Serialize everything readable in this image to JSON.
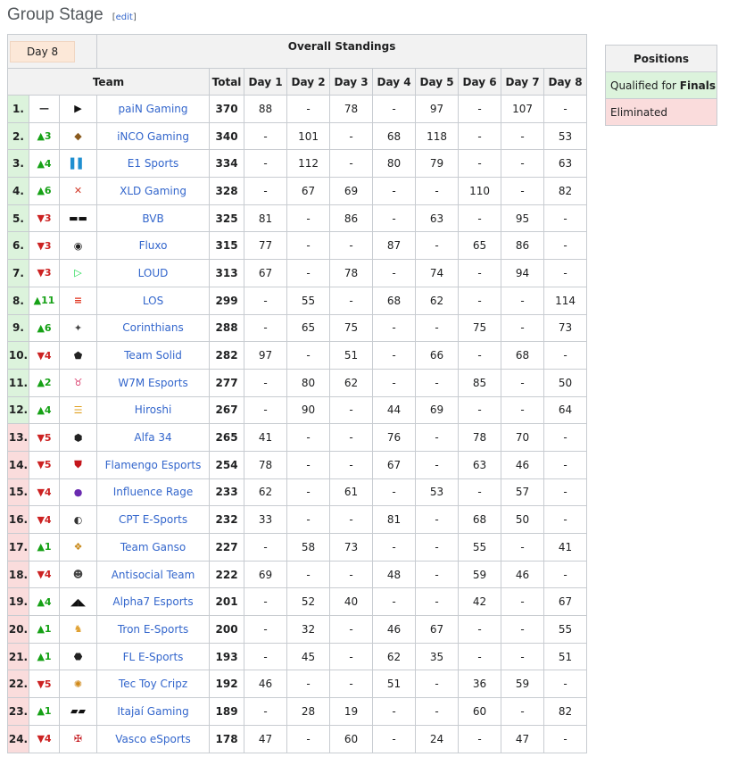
{
  "page": {
    "title": "Group Stage",
    "edit_label": "edit"
  },
  "table": {
    "day_selector": "Day 8",
    "overall_title": "Overall Standings",
    "headers": {
      "team": "Team",
      "total": "Total",
      "days": [
        "Day 1",
        "Day 2",
        "Day 3",
        "Day 4",
        "Day 5",
        "Day 6",
        "Day 7",
        "Day 8"
      ]
    },
    "rows": [
      {
        "rank": "1.",
        "change": "—",
        "dir": "same",
        "logo": "pain-gaming-logo",
        "name": "paiN Gaming",
        "total": "370",
        "days": [
          "88",
          "-",
          "78",
          "-",
          "97",
          "-",
          "107",
          "-"
        ],
        "status": "q"
      },
      {
        "rank": "2.",
        "change": "▲3",
        "dir": "up",
        "logo": "inco-gaming-logo",
        "name": "iNCO Gaming",
        "total": "340",
        "days": [
          "-",
          "101",
          "-",
          "68",
          "118",
          "-",
          "-",
          "53"
        ],
        "status": "q"
      },
      {
        "rank": "3.",
        "change": "▲4",
        "dir": "up",
        "logo": "e1-sports-logo",
        "name": "E1 Sports",
        "total": "334",
        "days": [
          "-",
          "112",
          "-",
          "80",
          "79",
          "-",
          "-",
          "63"
        ],
        "status": "q"
      },
      {
        "rank": "4.",
        "change": "▲6",
        "dir": "up",
        "logo": "xld-gaming-logo",
        "name": "XLD Gaming",
        "total": "328",
        "days": [
          "-",
          "67",
          "69",
          "-",
          "-",
          "110",
          "-",
          "82"
        ],
        "status": "q"
      },
      {
        "rank": "5.",
        "change": "▼3",
        "dir": "down",
        "logo": "bvb-logo",
        "name": "BVB",
        "total": "325",
        "days": [
          "81",
          "-",
          "86",
          "-",
          "63",
          "-",
          "95",
          "-"
        ],
        "status": "q"
      },
      {
        "rank": "6.",
        "change": "▼3",
        "dir": "down",
        "logo": "fluxo-logo",
        "name": "Fluxo",
        "total": "315",
        "days": [
          "77",
          "-",
          "-",
          "87",
          "-",
          "65",
          "86",
          "-"
        ],
        "status": "q"
      },
      {
        "rank": "7.",
        "change": "▼3",
        "dir": "down",
        "logo": "loud-logo",
        "name": "LOUD",
        "total": "313",
        "days": [
          "67",
          "-",
          "78",
          "-",
          "74",
          "-",
          "94",
          "-"
        ],
        "status": "q"
      },
      {
        "rank": "8.",
        "change": "▲11",
        "dir": "up",
        "logo": "los-logo",
        "name": "LOS",
        "total": "299",
        "days": [
          "-",
          "55",
          "-",
          "68",
          "62",
          "-",
          "-",
          "114"
        ],
        "status": "q"
      },
      {
        "rank": "9.",
        "change": "▲6",
        "dir": "up",
        "logo": "corinthians-logo",
        "name": "Corinthians",
        "total": "288",
        "days": [
          "-",
          "65",
          "75",
          "-",
          "-",
          "75",
          "-",
          "73"
        ],
        "status": "q"
      },
      {
        "rank": "10.",
        "change": "▼4",
        "dir": "down",
        "logo": "team-solid-logo",
        "name": "Team Solid",
        "total": "282",
        "days": [
          "97",
          "-",
          "51",
          "-",
          "66",
          "-",
          "68",
          "-"
        ],
        "status": "q"
      },
      {
        "rank": "11.",
        "change": "▲2",
        "dir": "up",
        "logo": "w7m-esports-logo",
        "name": "W7M Esports",
        "total": "277",
        "days": [
          "-",
          "80",
          "62",
          "-",
          "-",
          "85",
          "-",
          "50"
        ],
        "status": "q"
      },
      {
        "rank": "12.",
        "change": "▲4",
        "dir": "up",
        "logo": "hiroshi-logo",
        "name": "Hiroshi",
        "total": "267",
        "days": [
          "-",
          "90",
          "-",
          "44",
          "69",
          "-",
          "-",
          "64"
        ],
        "status": "q"
      },
      {
        "rank": "13.",
        "change": "▼5",
        "dir": "down",
        "logo": "alfa34-logo",
        "name": "Alfa 34",
        "total": "265",
        "days": [
          "41",
          "-",
          "-",
          "76",
          "-",
          "78",
          "70",
          "-"
        ],
        "status": "e"
      },
      {
        "rank": "14.",
        "change": "▼5",
        "dir": "down",
        "logo": "flamengo-logo",
        "name": "Flamengo Esports",
        "total": "254",
        "days": [
          "78",
          "-",
          "-",
          "67",
          "-",
          "63",
          "46",
          "-"
        ],
        "status": "e"
      },
      {
        "rank": "15.",
        "change": "▼4",
        "dir": "down",
        "logo": "influence-rage-logo",
        "name": "Influence Rage",
        "total": "233",
        "days": [
          "62",
          "-",
          "61",
          "-",
          "53",
          "-",
          "57",
          "-"
        ],
        "status": "e"
      },
      {
        "rank": "16.",
        "change": "▼4",
        "dir": "down",
        "logo": "cpt-esports-logo",
        "name": "CPT E-Sports",
        "total": "232",
        "days": [
          "33",
          "-",
          "-",
          "81",
          "-",
          "68",
          "50",
          "-"
        ],
        "status": "e"
      },
      {
        "rank": "17.",
        "change": "▲1",
        "dir": "up",
        "logo": "team-ganso-logo",
        "name": "Team Ganso",
        "total": "227",
        "days": [
          "-",
          "58",
          "73",
          "-",
          "-",
          "55",
          "-",
          "41"
        ],
        "status": "e"
      },
      {
        "rank": "18.",
        "change": "▼4",
        "dir": "down",
        "logo": "antisocial-team-logo",
        "name": "Antisocial Team",
        "total": "222",
        "days": [
          "69",
          "-",
          "-",
          "48",
          "-",
          "59",
          "46",
          "-"
        ],
        "status": "e"
      },
      {
        "rank": "19.",
        "change": "▲4",
        "dir": "up",
        "logo": "alpha7-logo",
        "name": "Alpha7 Esports",
        "total": "201",
        "days": [
          "-",
          "52",
          "40",
          "-",
          "-",
          "42",
          "-",
          "67"
        ],
        "status": "e"
      },
      {
        "rank": "20.",
        "change": "▲1",
        "dir": "up",
        "logo": "tron-esports-logo",
        "name": "Tron E-Sports",
        "total": "200",
        "days": [
          "-",
          "32",
          "-",
          "46",
          "67",
          "-",
          "-",
          "55"
        ],
        "status": "e"
      },
      {
        "rank": "21.",
        "change": "▲1",
        "dir": "up",
        "logo": "fl-esports-logo",
        "name": "FL E-Sports",
        "total": "193",
        "days": [
          "-",
          "45",
          "-",
          "62",
          "35",
          "-",
          "-",
          "51"
        ],
        "status": "e"
      },
      {
        "rank": "22.",
        "change": "▼5",
        "dir": "down",
        "logo": "tec-toy-cripz-logo",
        "name": "Tec Toy Cripz",
        "total": "192",
        "days": [
          "46",
          "-",
          "-",
          "51",
          "-",
          "36",
          "59",
          "-"
        ],
        "status": "e"
      },
      {
        "rank": "23.",
        "change": "▲1",
        "dir": "up",
        "logo": "itajai-gaming-logo",
        "name": "Itajaí Gaming",
        "total": "189",
        "days": [
          "-",
          "28",
          "19",
          "-",
          "-",
          "60",
          "-",
          "82"
        ],
        "status": "e"
      },
      {
        "rank": "24.",
        "change": "▼4",
        "dir": "down",
        "logo": "vasco-esports-logo",
        "name": "Vasco eSports",
        "total": "178",
        "days": [
          "47",
          "-",
          "60",
          "-",
          "24",
          "-",
          "47",
          "-"
        ],
        "status": "e"
      }
    ]
  },
  "legend": {
    "title": "Positions",
    "qualified_prefix": "Qualified for ",
    "qualified_bold": "Finals",
    "eliminated": "Eliminated"
  },
  "colors": {
    "qualified": "#dcf3dc",
    "eliminated": "#fadcdc",
    "link": "#3366cc",
    "up": "#16a116",
    "down": "#cc2222"
  }
}
